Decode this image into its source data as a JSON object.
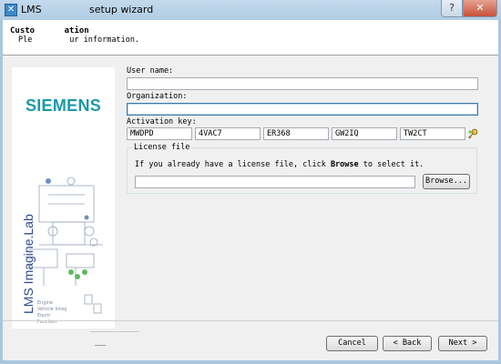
{
  "window": {
    "title": "LMS               setup wizard",
    "help_label": "?",
    "close_label": "✕"
  },
  "header": {
    "title": "Custo      ation",
    "subtitle": "Ple        ur information."
  },
  "side_image": {
    "logo": "SIEMENS",
    "product": "LMS Imagine.Lab",
    "diagram_lines": [
      "Engine",
      "Vehicle Integ",
      "Electr",
      "Function"
    ]
  },
  "form": {
    "user_name_label": "User name:",
    "user_name_value": "",
    "organization_label": "Organization:",
    "organization_value": "",
    "activation_key_label": "Activation key:",
    "activation_key_parts": [
      "MWDPD",
      "4VAC7",
      "ER368",
      "GW2IQ",
      "TW2CT"
    ]
  },
  "license": {
    "group_title": "License file",
    "description_pre": "If you already have a license file, click ",
    "description_bold": "Browse",
    "description_post": " to select it.",
    "file_value": "",
    "browse_label": "Browse..."
  },
  "footer": {
    "cancel_label": "Cancel",
    "back_label": "< Back",
    "next_label": "Next >"
  },
  "colors": {
    "siemens_teal": "#1b99a8",
    "product_blue": "#2e4a8e",
    "focus_border": "#3d7bad"
  }
}
